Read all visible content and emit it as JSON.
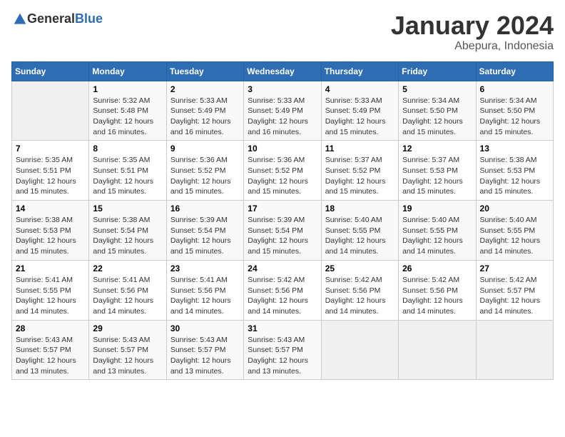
{
  "header": {
    "logo": {
      "general": "General",
      "blue": "Blue"
    },
    "title": "January 2024",
    "location": "Abepura, Indonesia"
  },
  "calendar": {
    "days_of_week": [
      "Sunday",
      "Monday",
      "Tuesday",
      "Wednesday",
      "Thursday",
      "Friday",
      "Saturday"
    ],
    "weeks": [
      [
        {
          "day": null,
          "sunrise": null,
          "sunset": null,
          "daylight": null
        },
        {
          "day": "1",
          "sunrise": "Sunrise: 5:32 AM",
          "sunset": "Sunset: 5:48 PM",
          "daylight": "Daylight: 12 hours and 16 minutes."
        },
        {
          "day": "2",
          "sunrise": "Sunrise: 5:33 AM",
          "sunset": "Sunset: 5:49 PM",
          "daylight": "Daylight: 12 hours and 16 minutes."
        },
        {
          "day": "3",
          "sunrise": "Sunrise: 5:33 AM",
          "sunset": "Sunset: 5:49 PM",
          "daylight": "Daylight: 12 hours and 16 minutes."
        },
        {
          "day": "4",
          "sunrise": "Sunrise: 5:33 AM",
          "sunset": "Sunset: 5:49 PM",
          "daylight": "Daylight: 12 hours and 15 minutes."
        },
        {
          "day": "5",
          "sunrise": "Sunrise: 5:34 AM",
          "sunset": "Sunset: 5:50 PM",
          "daylight": "Daylight: 12 hours and 15 minutes."
        },
        {
          "day": "6",
          "sunrise": "Sunrise: 5:34 AM",
          "sunset": "Sunset: 5:50 PM",
          "daylight": "Daylight: 12 hours and 15 minutes."
        }
      ],
      [
        {
          "day": "7",
          "sunrise": "Sunrise: 5:35 AM",
          "sunset": "Sunset: 5:51 PM",
          "daylight": "Daylight: 12 hours and 15 minutes."
        },
        {
          "day": "8",
          "sunrise": "Sunrise: 5:35 AM",
          "sunset": "Sunset: 5:51 PM",
          "daylight": "Daylight: 12 hours and 15 minutes."
        },
        {
          "day": "9",
          "sunrise": "Sunrise: 5:36 AM",
          "sunset": "Sunset: 5:52 PM",
          "daylight": "Daylight: 12 hours and 15 minutes."
        },
        {
          "day": "10",
          "sunrise": "Sunrise: 5:36 AM",
          "sunset": "Sunset: 5:52 PM",
          "daylight": "Daylight: 12 hours and 15 minutes."
        },
        {
          "day": "11",
          "sunrise": "Sunrise: 5:37 AM",
          "sunset": "Sunset: 5:52 PM",
          "daylight": "Daylight: 12 hours and 15 minutes."
        },
        {
          "day": "12",
          "sunrise": "Sunrise: 5:37 AM",
          "sunset": "Sunset: 5:53 PM",
          "daylight": "Daylight: 12 hours and 15 minutes."
        },
        {
          "day": "13",
          "sunrise": "Sunrise: 5:38 AM",
          "sunset": "Sunset: 5:53 PM",
          "daylight": "Daylight: 12 hours and 15 minutes."
        }
      ],
      [
        {
          "day": "14",
          "sunrise": "Sunrise: 5:38 AM",
          "sunset": "Sunset: 5:53 PM",
          "daylight": "Daylight: 12 hours and 15 minutes."
        },
        {
          "day": "15",
          "sunrise": "Sunrise: 5:38 AM",
          "sunset": "Sunset: 5:54 PM",
          "daylight": "Daylight: 12 hours and 15 minutes."
        },
        {
          "day": "16",
          "sunrise": "Sunrise: 5:39 AM",
          "sunset": "Sunset: 5:54 PM",
          "daylight": "Daylight: 12 hours and 15 minutes."
        },
        {
          "day": "17",
          "sunrise": "Sunrise: 5:39 AM",
          "sunset": "Sunset: 5:54 PM",
          "daylight": "Daylight: 12 hours and 15 minutes."
        },
        {
          "day": "18",
          "sunrise": "Sunrise: 5:40 AM",
          "sunset": "Sunset: 5:55 PM",
          "daylight": "Daylight: 12 hours and 14 minutes."
        },
        {
          "day": "19",
          "sunrise": "Sunrise: 5:40 AM",
          "sunset": "Sunset: 5:55 PM",
          "daylight": "Daylight: 12 hours and 14 minutes."
        },
        {
          "day": "20",
          "sunrise": "Sunrise: 5:40 AM",
          "sunset": "Sunset: 5:55 PM",
          "daylight": "Daylight: 12 hours and 14 minutes."
        }
      ],
      [
        {
          "day": "21",
          "sunrise": "Sunrise: 5:41 AM",
          "sunset": "Sunset: 5:55 PM",
          "daylight": "Daylight: 12 hours and 14 minutes."
        },
        {
          "day": "22",
          "sunrise": "Sunrise: 5:41 AM",
          "sunset": "Sunset: 5:56 PM",
          "daylight": "Daylight: 12 hours and 14 minutes."
        },
        {
          "day": "23",
          "sunrise": "Sunrise: 5:41 AM",
          "sunset": "Sunset: 5:56 PM",
          "daylight": "Daylight: 12 hours and 14 minutes."
        },
        {
          "day": "24",
          "sunrise": "Sunrise: 5:42 AM",
          "sunset": "Sunset: 5:56 PM",
          "daylight": "Daylight: 12 hours and 14 minutes."
        },
        {
          "day": "25",
          "sunrise": "Sunrise: 5:42 AM",
          "sunset": "Sunset: 5:56 PM",
          "daylight": "Daylight: 12 hours and 14 minutes."
        },
        {
          "day": "26",
          "sunrise": "Sunrise: 5:42 AM",
          "sunset": "Sunset: 5:56 PM",
          "daylight": "Daylight: 12 hours and 14 minutes."
        },
        {
          "day": "27",
          "sunrise": "Sunrise: 5:42 AM",
          "sunset": "Sunset: 5:57 PM",
          "daylight": "Daylight: 12 hours and 14 minutes."
        }
      ],
      [
        {
          "day": "28",
          "sunrise": "Sunrise: 5:43 AM",
          "sunset": "Sunset: 5:57 PM",
          "daylight": "Daylight: 12 hours and 13 minutes."
        },
        {
          "day": "29",
          "sunrise": "Sunrise: 5:43 AM",
          "sunset": "Sunset: 5:57 PM",
          "daylight": "Daylight: 12 hours and 13 minutes."
        },
        {
          "day": "30",
          "sunrise": "Sunrise: 5:43 AM",
          "sunset": "Sunset: 5:57 PM",
          "daylight": "Daylight: 12 hours and 13 minutes."
        },
        {
          "day": "31",
          "sunrise": "Sunrise: 5:43 AM",
          "sunset": "Sunset: 5:57 PM",
          "daylight": "Daylight: 12 hours and 13 minutes."
        },
        {
          "day": null,
          "sunrise": null,
          "sunset": null,
          "daylight": null
        },
        {
          "day": null,
          "sunrise": null,
          "sunset": null,
          "daylight": null
        },
        {
          "day": null,
          "sunrise": null,
          "sunset": null,
          "daylight": null
        }
      ]
    ]
  }
}
